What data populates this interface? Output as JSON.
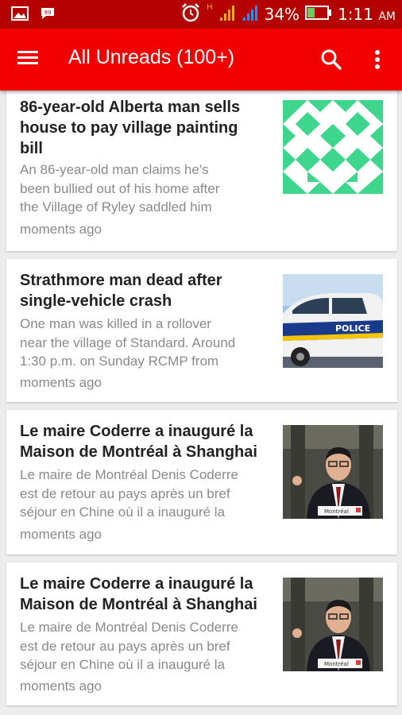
{
  "status_bar": {
    "battery_percent": "34%",
    "time": "1:11",
    "ampm": "AM",
    "network_type": "H"
  },
  "app_bar": {
    "title": "All Unreads (100+)",
    "menu_icon": "hamburger-menu-icon",
    "search_icon": "search-icon",
    "more_icon": "more-vert-icon"
  },
  "colors": {
    "app_bar": "#f20000",
    "status_bar": "#b50000",
    "background": "#ececec",
    "pattern_green": "#3dd68c"
  },
  "articles": [
    {
      "title_lines": [
        "86-year-old Alberta man sells",
        "house to pay village painting",
        "bill"
      ],
      "snippet_lines": [
        "An 86-year-old man claims he's",
        "been bullied out of his home after",
        "the Village of Ryley saddled him"
      ],
      "time": "moments ago",
      "image": "geometric-pattern"
    },
    {
      "title_lines": [
        "Strathmore man dead after",
        "single-vehicle crash"
      ],
      "snippet_lines": [
        "One man was killed in a rollover",
        "near the village of Standard. Around",
        "1:30 p.m. on Sunday RCMP from"
      ],
      "time": "moments ago",
      "image": "police-car",
      "image_text": "POLICE"
    },
    {
      "title_lines": [
        "Le maire Coderre a inauguré la",
        "Maison de Montréal à Shanghai"
      ],
      "snippet_lines": [
        "Le maire de Montréal Denis Coderre",
        "est de retour au pays après un bref",
        "séjour en Chine où il a inauguré la"
      ],
      "time": "moments ago",
      "image": "mayor-at-podium",
      "image_text": "Montréal"
    },
    {
      "title_lines": [
        "Le maire Coderre a inauguré la",
        "Maison de Montréal à Shanghai"
      ],
      "snippet_lines": [
        "Le maire de Montréal Denis Coderre",
        "est de retour au pays après un bref",
        "séjour en Chine où il a inauguré la"
      ],
      "time": "moments ago",
      "image": "mayor-at-podium",
      "image_text": "Montréal"
    }
  ]
}
